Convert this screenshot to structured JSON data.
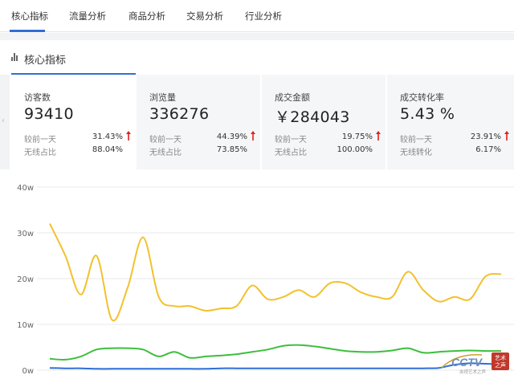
{
  "topnav": {
    "tabs": [
      {
        "label": "核心指标",
        "active": true
      },
      {
        "label": "流量分析",
        "active": false
      },
      {
        "label": "商品分析",
        "active": false
      },
      {
        "label": "交易分析",
        "active": false
      },
      {
        "label": "行业分析",
        "active": false
      }
    ]
  },
  "section": {
    "title": "核心指标",
    "icon": "bar-chart-icon"
  },
  "kpis": [
    {
      "label": "访客数",
      "value": "93410",
      "row1_label": "较前一天",
      "row1_value": "31.43%",
      "row1_trend": "up",
      "row2_label": "无线占比",
      "row2_value": "88.04%",
      "active": true
    },
    {
      "label": "浏览量",
      "value": "336276",
      "row1_label": "较前一天",
      "row1_value": "44.39%",
      "row1_trend": "up",
      "row2_label": "无线占比",
      "row2_value": "73.85%",
      "active": false
    },
    {
      "label": "成交金额",
      "value": "￥284043",
      "row1_label": "较前一天",
      "row1_value": "19.75%",
      "row1_trend": "up",
      "row2_label": "无线占比",
      "row2_value": "100.00%",
      "active": false
    },
    {
      "label": "成交转化率",
      "value": "5.43 %",
      "row1_label": "较前一天",
      "row1_value": "23.91%",
      "row1_trend": "up",
      "row2_label": "无线转化",
      "row2_value": "6.17%",
      "active": false
    }
  ],
  "colors": {
    "accent": "#2f6fd6",
    "trend_up": "#e02020",
    "series_yellow": "#f2c12e",
    "series_green": "#3cbf3c",
    "series_blue": "#2f6fd6"
  },
  "watermark": {
    "brand": "CCTV",
    "side_text": "艺术之声",
    "small_text": "央视艺术之声"
  },
  "chart_data": {
    "type": "line",
    "ylim": [
      0,
      40
    ],
    "yticks": [
      0,
      10,
      20,
      30,
      40
    ],
    "ytick_labels": [
      "0w",
      "10w",
      "20w",
      "30w",
      "40w"
    ],
    "grid": true,
    "series": [
      {
        "color": "yellow",
        "values": [
          32,
          25,
          16.5,
          25,
          11,
          18,
          29,
          16,
          14,
          14,
          13,
          13.5,
          14,
          18.5,
          15.5,
          16,
          17.5,
          16,
          19,
          19,
          17,
          16,
          16,
          21.5,
          17.5,
          15,
          16,
          15.5,
          20.5,
          21
        ]
      },
      {
        "color": "green",
        "values": [
          2.5,
          2.3,
          3,
          4.5,
          4.8,
          4.8,
          4.5,
          3,
          4,
          2.7,
          3,
          3.2,
          3.5,
          4,
          4.5,
          5.3,
          5.5,
          5.2,
          4.7,
          4.2,
          4,
          4,
          4.3,
          4.8,
          3.8,
          4,
          4.2,
          4.3,
          4.2,
          4.2
        ]
      },
      {
        "color": "blue",
        "values": [
          0.5,
          0.4,
          0.4,
          0.3,
          0.3,
          0.3,
          0.3,
          0.3,
          0.3,
          0.3,
          0.3,
          0.4,
          0.4,
          0.4,
          0.4,
          0.4,
          0.4,
          0.4,
          0.4,
          0.4,
          0.4,
          0.4,
          0.4,
          0.4,
          0.4,
          0.5,
          1.2,
          1.5,
          1.4,
          1.3
        ]
      }
    ]
  }
}
